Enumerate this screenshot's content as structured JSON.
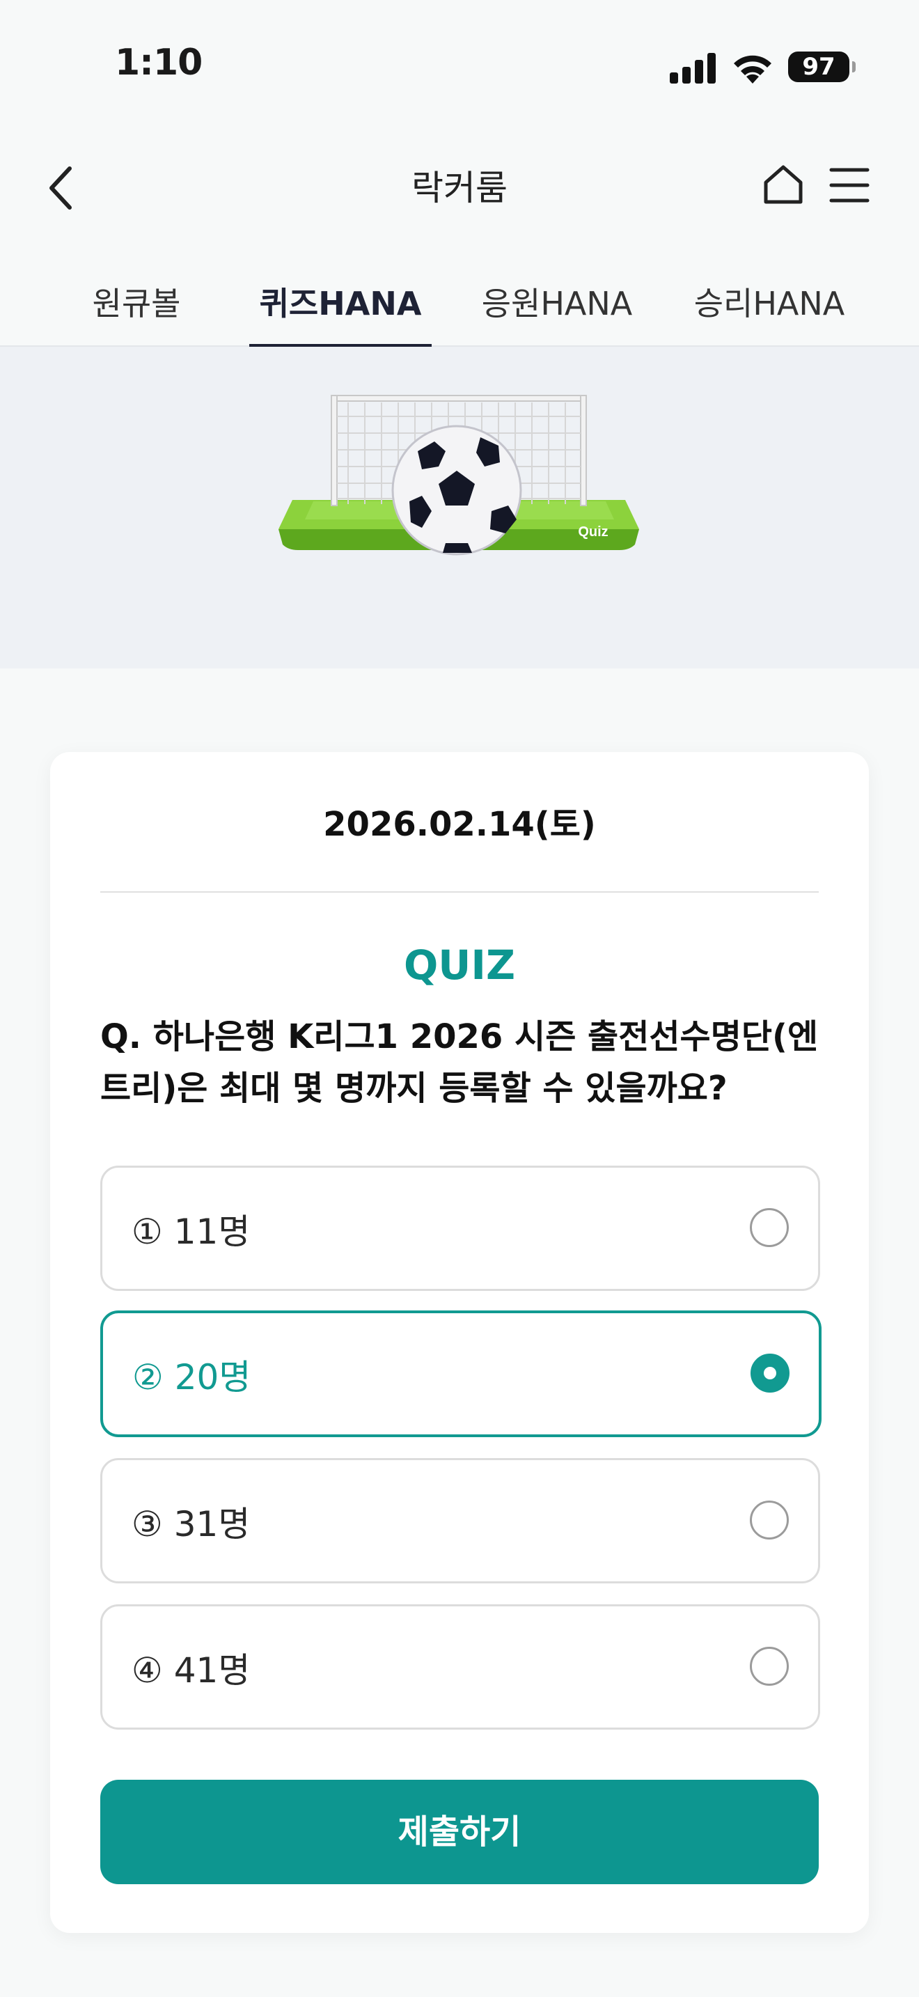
{
  "status_bar": {
    "time": "1:10",
    "battery": "97"
  },
  "header": {
    "title": "락커룸"
  },
  "tabs": [
    {
      "label": "원큐볼",
      "active": false
    },
    {
      "label": "퀴즈HANA",
      "active": true
    },
    {
      "label": "응원HANA",
      "active": false
    },
    {
      "label": "승리HANA",
      "active": false
    }
  ],
  "banner": {
    "badge": "Quiz"
  },
  "quiz": {
    "date": "2026.02.14(토)",
    "label": "QUIZ",
    "question": "Q. 하나은행 K리그1 2026 시즌 출전선수명단(엔트리)은 최대 몇 명까지 등록할 수 있을까요?",
    "options": [
      {
        "label": "① 11명",
        "selected": false
      },
      {
        "label": "② 20명",
        "selected": true
      },
      {
        "label": "③ 31명",
        "selected": false
      },
      {
        "label": "④ 41명",
        "selected": false
      }
    ],
    "submit_label": "제출하기"
  },
  "colors": {
    "accent": "#0d9690",
    "tab_active": "#1e2235",
    "banner_bg": "#eef1f5"
  }
}
